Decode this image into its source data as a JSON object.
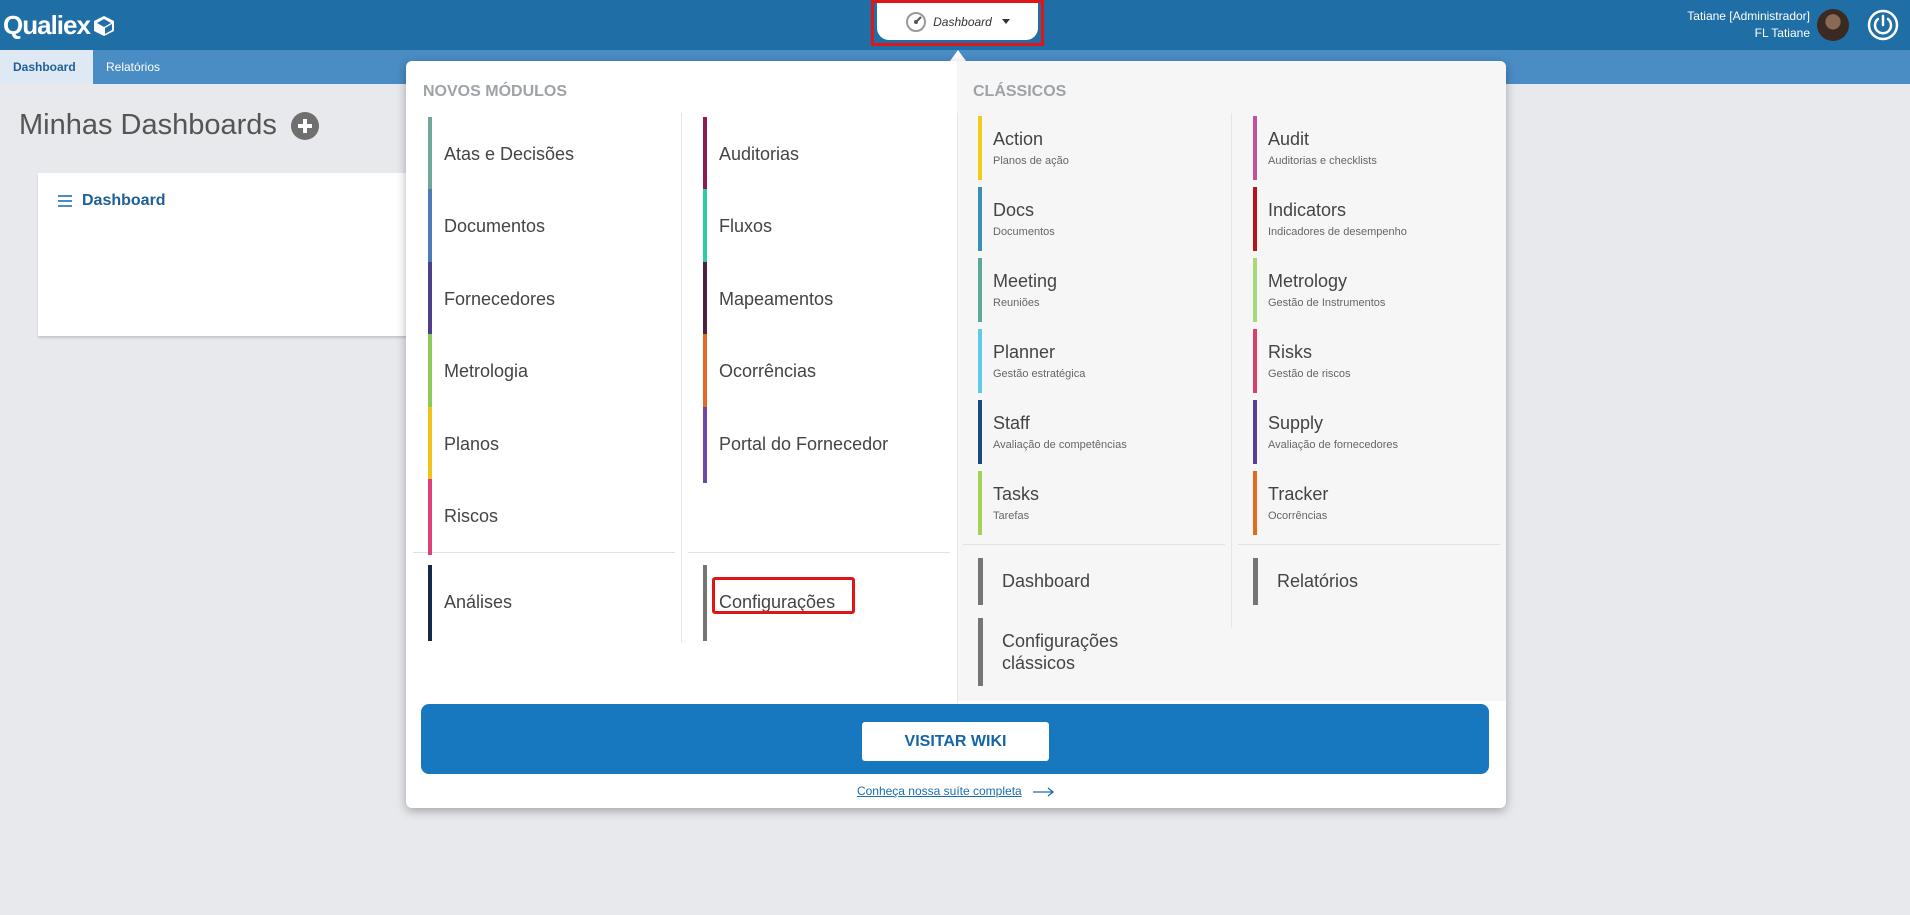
{
  "header": {
    "logo_text": "Qualiex",
    "switcher_label": "Dashboard",
    "user_line1": "Tatiane [Administrador]",
    "user_line2": "FL Tatiane"
  },
  "nav": {
    "tabs": [
      {
        "label": "Dashboard",
        "active": true
      },
      {
        "label": "Relatórios",
        "active": false
      }
    ]
  },
  "page": {
    "title": "Minhas Dashboards",
    "card_title": "Dashboard"
  },
  "menu": {
    "novos_title": "NOVOS MÓDULOS",
    "classicos_title": "CLÁSSICOS",
    "novos_col1": [
      {
        "label": "Atas e Decisões",
        "color": "#6fa89a"
      },
      {
        "label": "Documentos",
        "color": "#4d7bb6"
      },
      {
        "label": "Fornecedores",
        "color": "#4d3f8c"
      },
      {
        "label": "Metrologia",
        "color": "#8ccb58"
      },
      {
        "label": "Planos",
        "color": "#f2c21b"
      },
      {
        "label": "Riscos",
        "color": "#e0407a"
      }
    ],
    "novos_col2": [
      {
        "label": "Auditorias",
        "color": "#8c1d52"
      },
      {
        "label": "Fluxos",
        "color": "#2bcf9f"
      },
      {
        "label": "Mapeamentos",
        "color": "#4a2340"
      },
      {
        "label": "Ocorrências",
        "color": "#e46a23"
      },
      {
        "label": "Portal do Fornecedor",
        "color": "#6b47a8"
      }
    ],
    "analises": {
      "label": "Análises",
      "color": "#122a48"
    },
    "configuracoes": {
      "label": "Configurações",
      "color": "#757575"
    },
    "classicos_col1": [
      {
        "name": "Action",
        "sub": "Planos de ação",
        "color": "#f2cc1c"
      },
      {
        "name": "Docs",
        "sub": "Documentos",
        "color": "#3a8fb5"
      },
      {
        "name": "Meeting",
        "sub": "Reuniões",
        "color": "#5ea899"
      },
      {
        "name": "Planner",
        "sub": "Gestão estratégica",
        "color": "#5fcbea"
      },
      {
        "name": "Staff",
        "sub": "Avaliação de competências",
        "color": "#1d4780"
      },
      {
        "name": "Tasks",
        "sub": "Tarefas",
        "color": "#a3d255"
      }
    ],
    "classicos_col2": [
      {
        "name": "Audit",
        "sub": "Auditorias e checklists",
        "color": "#c4519c"
      },
      {
        "name": "Indicators",
        "sub": "Indicadores de desempenho",
        "color": "#b5141d"
      },
      {
        "name": "Metrology",
        "sub": "Gestão de Instrumentos",
        "color": "#a8d978"
      },
      {
        "name": "Risks",
        "sub": "Gestão de riscos",
        "color": "#d83f6b"
      },
      {
        "name": "Supply",
        "sub": "Avaliação de fornecedores",
        "color": "#5a3d94"
      },
      {
        "name": "Tracker",
        "sub": "Ocorrências",
        "color": "#e46a1f"
      }
    ],
    "classicos_dashboard": "Dashboard",
    "classicos_relatorios": "Relatórios",
    "classicos_config_line1": "Configurações",
    "classicos_config_line2": "clássicos",
    "wiki_button": "VISITAR WIKI",
    "suite_link": "Conheça nossa suíte completa"
  }
}
